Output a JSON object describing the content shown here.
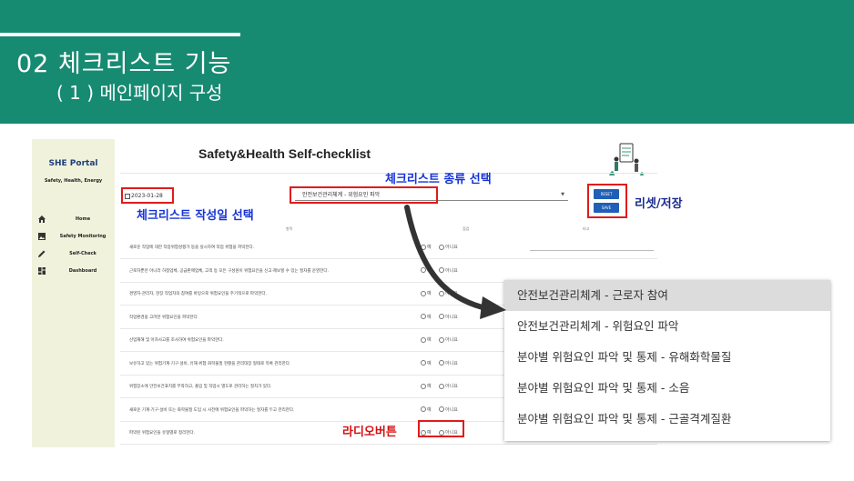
{
  "slide": {
    "title": "02 체크리스트 기능",
    "subtitle": "( 1 ) 메인페이지 구성"
  },
  "app": {
    "brand": "SHE Portal",
    "brand_sub": "Safety, Health, Energy",
    "nav": [
      {
        "label": "Home",
        "icon": "home-icon"
      },
      {
        "label": "Safety Monitoring",
        "icon": "image-icon"
      },
      {
        "label": "Self-Check",
        "icon": "pencil-icon"
      },
      {
        "label": "Dashboard",
        "icon": "dashboard-icon"
      }
    ],
    "title": "Safety&Health Self-checklist",
    "date_value": "2023-01-28",
    "checklist_type": "안전보건관리체계 - 위험요인 파악",
    "reset_label": "RESET",
    "save_label": "SAVE",
    "columns": {
      "item": "항목",
      "check": "점검",
      "remark": "비고"
    },
    "radio_yes": "예",
    "radio_no": "아니요",
    "rows": [
      "새로운 작업에 대한 작업위험성평가 등을 실시하여 작업 위험을 파악한다.",
      "근로자뿐만 아니라 하청업체, 공급판매업체, 고객 등 모든 구성원이 위험요인을 신고·제보할 수 있는 절차를 운영한다.",
      "경영자·관리자, 현장 작업자의 참여를 바탕으로 위험요인을 주기적으로 파악한다.",
      "작업환경을 고려한 위험요인을 파악한다.",
      "산업재해 및 아차사고를 조사하여 위험요인을 파악한다.",
      "보유하고 있는 위험기계·기구·설비, 유해·위험 화학물질 현황을 관리대장 형태로 목록 관리한다.",
      "위험장소에 안전보건표지를 부착하고, 출입 및 작업시 별도로 관리하는 절차가 있다.",
      "새로운 기계·기구·설비 또는 화학물질 도입 시 사전에 위험요인을 파악하는 절차를 두고 관리한다.",
      "파악된 위험요인을 유형별로 정리한다."
    ]
  },
  "annotations": {
    "checklist_type_select": "체크리스트 종류 선택",
    "date_select": "체크리스트 작성일 선택",
    "reset_save": "리셋/저장",
    "radio_button": "라디오버튼"
  },
  "dropdown": {
    "options": [
      "안전보건관리체계 - 근로자 참여",
      "안전보건관리체계 - 위험요인 파악",
      "분야별 위험요인 파악 및 통제 - 유해화학물질",
      "분야별 위험요인 파악 및 통제 - 소음",
      "분야별 위험요인 파악 및 통제 - 근골격계질환"
    ],
    "highlighted_index": 0
  },
  "colors": {
    "banner": "#178a72",
    "sidebar": "#f1f2dc",
    "button": "#1f5fb8",
    "annotation_red": "#e01b1b",
    "annotation_blue": "#1533d6"
  }
}
